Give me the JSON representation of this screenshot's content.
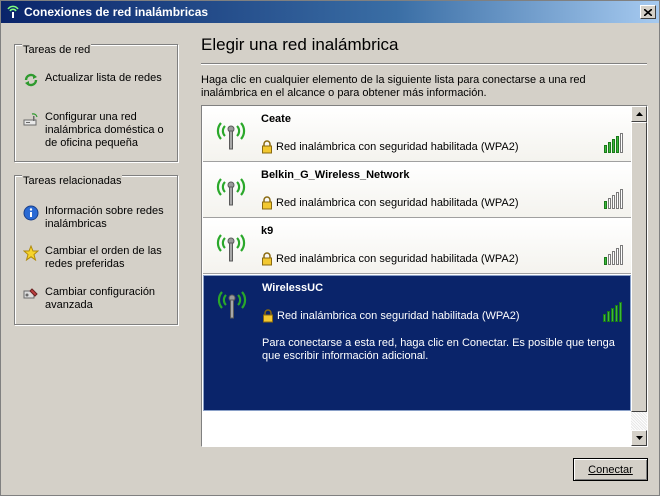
{
  "window": {
    "title": "Conexiones de red inalámbricas",
    "icon": "wireless-network-icon"
  },
  "sidebar": {
    "network_tasks": {
      "title": "Tareas de red",
      "items": [
        {
          "label": "Actualizar lista de redes",
          "icon": "refresh-icon"
        },
        {
          "label": "Configurar una red inalámbrica doméstica o de oficina pequeña",
          "icon": "setup-wizard-icon"
        }
      ]
    },
    "related_tasks": {
      "title": "Tareas relacionadas",
      "items": [
        {
          "label": "Información sobre redes inalámbricas",
          "icon": "info-icon"
        },
        {
          "label": "Cambiar el orden de las redes preferidas",
          "icon": "star-icon"
        },
        {
          "label": "Cambiar configuración avanzada",
          "icon": "settings-icon"
        }
      ]
    }
  },
  "main": {
    "title": "Elegir una red inalámbrica",
    "description": "Haga clic en cualquier elemento de la siguiente lista para conectarse a una red inalámbrica en el alcance o para obtener más información.",
    "networks": [
      {
        "name": "Ceate",
        "security": "Red inalámbrica con seguridad habilitada (WPA2)",
        "signal_bars": 4,
        "selected": false
      },
      {
        "name": "Belkin_G_Wireless_Network",
        "security": "Red inalámbrica con seguridad habilitada (WPA2)",
        "signal_bars": 1,
        "selected": false
      },
      {
        "name": "k9",
        "security": "Red inalámbrica con seguridad habilitada (WPA2)",
        "signal_bars": 1,
        "selected": false
      },
      {
        "name": "WirelessUC",
        "security": "Red inalámbrica con seguridad habilitada (WPA2)",
        "signal_bars": 5,
        "selected": true,
        "hint": "Para conectarse a esta red, haga clic en Conectar. Es posible que tenga que escribir información adicional."
      }
    ]
  },
  "footer": {
    "connect_label": "Conectar"
  },
  "colors": {
    "selected_bg": "#0a246a",
    "signal_green": "#3db93d",
    "window_bg": "#d4d0c8"
  }
}
